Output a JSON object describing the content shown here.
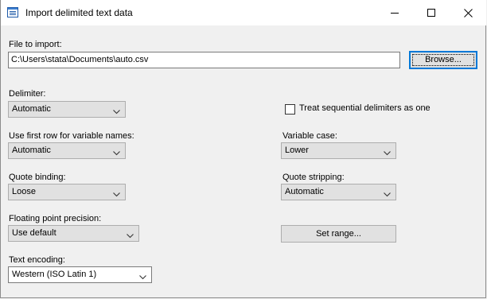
{
  "window": {
    "title": "Import delimited text data",
    "controls": {
      "minimize_icon": "minimize-icon",
      "maximize_icon": "maximize-icon",
      "close_icon": "close-icon"
    }
  },
  "file": {
    "label": "File to import:",
    "value": "C:\\Users\\stata\\Documents\\auto.csv",
    "browse_label": "Browse..."
  },
  "delimiter": {
    "label": "Delimiter:",
    "value": "Automatic"
  },
  "sequential": {
    "label": "Treat sequential delimiters as one",
    "checked": false
  },
  "first_row": {
    "label": "Use first row  for variable names:",
    "value": "Automatic"
  },
  "variable_case": {
    "label": "Variable case:",
    "value": "Lower"
  },
  "quote_binding": {
    "label": "Quote binding:",
    "value": "Loose"
  },
  "quote_stripping": {
    "label": "Quote stripping:",
    "value": "Automatic"
  },
  "float_precision": {
    "label": "Floating point precision:",
    "value": "Use default"
  },
  "set_range": {
    "label": "Set range..."
  },
  "encoding": {
    "label": "Text encoding:",
    "value": "Western (ISO Latin 1)"
  },
  "colors": {
    "titlebar": "#ffffff",
    "dialog_bg": "#f0f0f0",
    "focus_border": "#0078d7"
  }
}
